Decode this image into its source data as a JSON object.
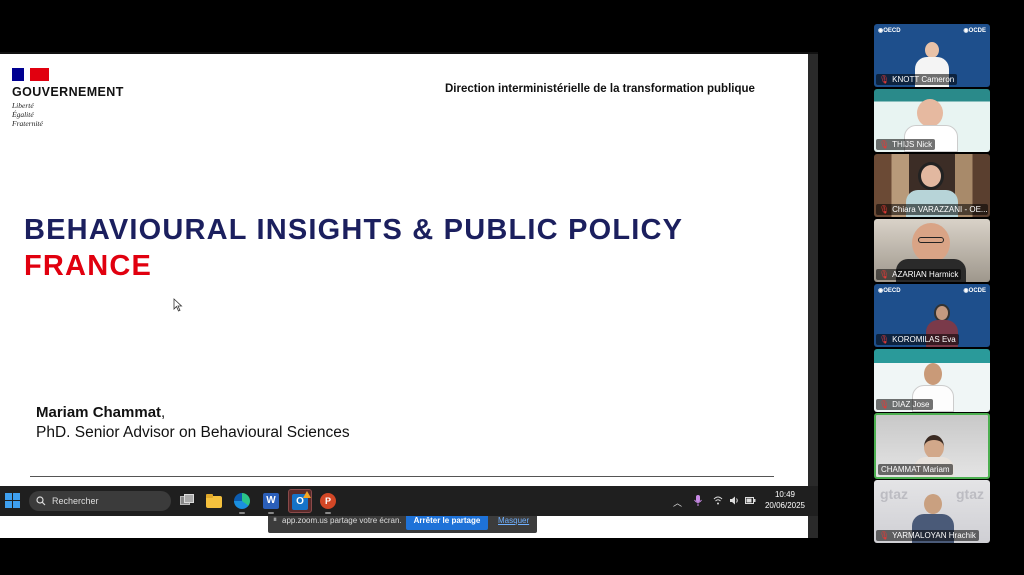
{
  "slide": {
    "gov_name": "GOUVERNEMENT",
    "motto": [
      "Liberté",
      "Égalité",
      "Fraternité"
    ],
    "direction": "Direction interministérielle de la transformation publique",
    "title_line1": "BEHAVIOURAL INSIGHTS & PUBLIC POLICY",
    "title_line2": "FRANCE",
    "author_name": "Mariam Chammat",
    "author_suffix": ",",
    "author_role": "PhD. Senior Advisor on Behavioural Sciences"
  },
  "share_bar": {
    "message": "app.zoom.us partage votre écran.",
    "stop_label": "Arrêter le partage",
    "hide_label": "Masquer"
  },
  "taskbar": {
    "search_placeholder": "Rechercher",
    "time": "10:49",
    "date": "20/06/2025",
    "apps": [
      "task-view-icon",
      "file-explorer-icon",
      "edge-icon",
      "word-icon",
      "outlook-icon",
      "powerpoint-icon"
    ]
  },
  "participants": [
    {
      "name": "KNOTT Cameron",
      "muted": true,
      "bg": "oecd"
    },
    {
      "name": "THIJS Nick",
      "muted": true,
      "bg": "light"
    },
    {
      "name": "Chiara VARAZZANI - OE...",
      "muted": true,
      "bg": "books"
    },
    {
      "name": "AZARIAN Harmick",
      "muted": true,
      "bg": "room"
    },
    {
      "name": "KOROMILAS Eva",
      "muted": true,
      "bg": "oecd"
    },
    {
      "name": "DIAZ Jose",
      "muted": true,
      "bg": "teal"
    },
    {
      "name": "CHAMMAT Mariam",
      "muted": false,
      "bg": "grey",
      "active": true
    },
    {
      "name": "YARMALOYAN Hrachik",
      "muted": true,
      "bg": "wall"
    }
  ],
  "colors": {
    "title_blue": "#1b1f5e",
    "title_red": "#e1000f",
    "stop_button": "#1e72d8",
    "active_speaker": "#4caf50"
  }
}
